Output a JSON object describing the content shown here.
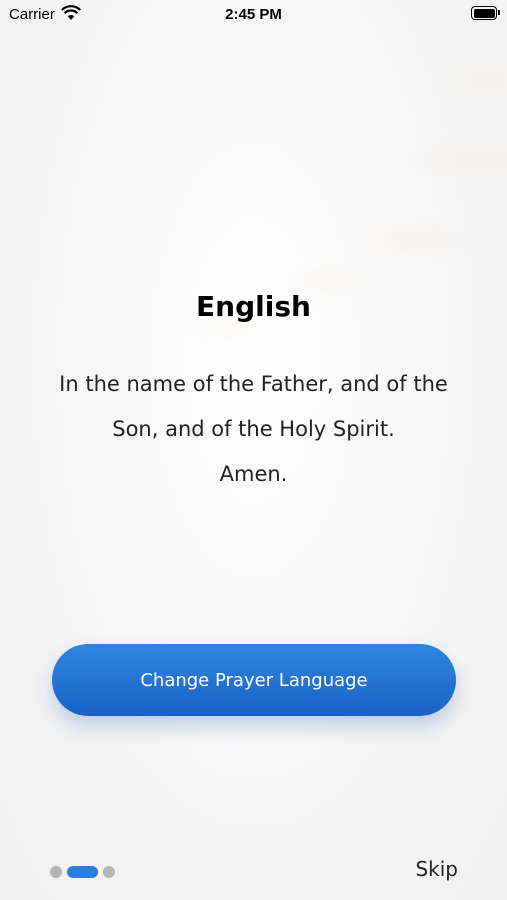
{
  "status_bar": {
    "carrier": "Carrier",
    "time": "2:45 PM"
  },
  "content": {
    "title": "English",
    "prayer_lines": [
      "In the name of the Father, and of the",
      "Son, and of the Holy Spirit.",
      "Amen."
    ]
  },
  "actions": {
    "change_language": "Change Prayer Language",
    "skip": "Skip"
  },
  "pager": {
    "total": 3,
    "active_index": 1
  },
  "colors": {
    "accent": "#2b7fe0",
    "button_top": "#2e86de",
    "button_bottom": "#1a62c9",
    "dot_inactive": "#b5b5b5"
  }
}
